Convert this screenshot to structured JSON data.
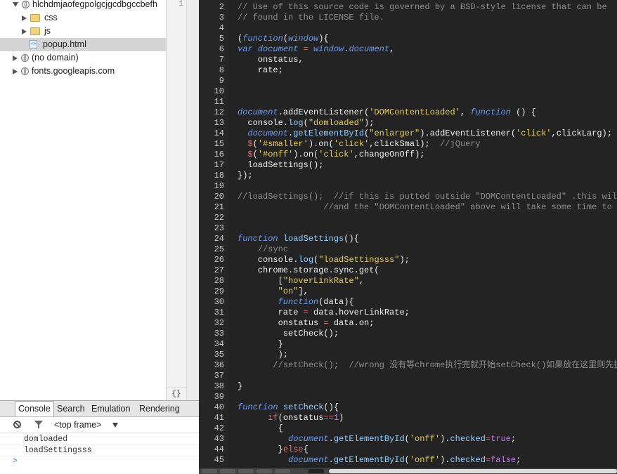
{
  "tree": {
    "root": "hlchdmjaofegpolgcjgcdbgccbefh",
    "items": [
      {
        "label": "css",
        "kind": "folder"
      },
      {
        "label": "js",
        "kind": "folder"
      },
      {
        "label": "popup.html",
        "kind": "html",
        "selected": true
      }
    ],
    "others": [
      "(no domain)",
      "fonts.googleapis.com"
    ]
  },
  "gutter_top_number": "1",
  "pretty_print_label": "{}",
  "drawer": {
    "tabs": [
      "Console",
      "Search",
      "Emulation",
      "Rendering"
    ],
    "active_tab": "Console",
    "frame_selector": "<top frame>",
    "messages": [
      "domloaded",
      "loadSettingsss"
    ],
    "prompt": ">"
  },
  "code": {
    "lines": [
      {
        "n": "2",
        "segs": [
          [
            "c",
            "// Use of this source code is governed by a BSD-style license that can be"
          ]
        ]
      },
      {
        "n": "3",
        "segs": [
          [
            "c",
            "// found in the LICENSE file."
          ]
        ]
      },
      {
        "n": "4",
        "segs": []
      },
      {
        "n": "5",
        "segs": [
          [
            "t",
            "("
          ],
          [
            "k",
            "function"
          ],
          [
            "t",
            "("
          ],
          [
            "v",
            "window"
          ],
          [
            "t",
            "){"
          ]
        ]
      },
      {
        "n": "6",
        "segs": [
          [
            "k",
            "var "
          ],
          [
            "v",
            "document"
          ],
          [
            "t",
            " "
          ],
          [
            "p",
            "="
          ],
          [
            "t",
            " "
          ],
          [
            "v",
            "window"
          ],
          [
            "t",
            "."
          ],
          [
            "v",
            "document"
          ],
          [
            "t",
            ","
          ]
        ]
      },
      {
        "n": "7",
        "segs": [
          [
            "t",
            "    onstatus,"
          ]
        ]
      },
      {
        "n": "8",
        "segs": [
          [
            "t",
            "    rate;"
          ]
        ]
      },
      {
        "n": "9",
        "segs": []
      },
      {
        "n": "10",
        "segs": []
      },
      {
        "n": "11",
        "segs": []
      },
      {
        "n": "12",
        "segs": [
          [
            "v",
            "document"
          ],
          [
            "t",
            ".addEventListener("
          ],
          [
            "s",
            "'DOMContentLoaded'"
          ],
          [
            "t",
            ", "
          ],
          [
            "k",
            "function"
          ],
          [
            "t",
            " () {"
          ]
        ]
      },
      {
        "n": "13",
        "segs": [
          [
            "t",
            "  console."
          ],
          [
            "f",
            "log"
          ],
          [
            "t",
            "("
          ],
          [
            "s",
            "\"domloaded\""
          ],
          [
            "t",
            ");"
          ]
        ]
      },
      {
        "n": "14",
        "segs": [
          [
            "t",
            "  "
          ],
          [
            "v",
            "document"
          ],
          [
            "t",
            "."
          ],
          [
            "f",
            "getElementById"
          ],
          [
            "t",
            "("
          ],
          [
            "s",
            "\"enlarger\""
          ],
          [
            "t",
            ").addEventListener("
          ],
          [
            "s",
            "'click'"
          ],
          [
            "t",
            ",clickLarg); //"
          ]
        ]
      },
      {
        "n": "15",
        "segs": [
          [
            "t",
            "  "
          ],
          [
            "p",
            "$"
          ],
          [
            "t",
            "("
          ],
          [
            "s",
            "'#smaller'"
          ],
          [
            "t",
            ").on("
          ],
          [
            "s",
            "'click'"
          ],
          [
            "t",
            ",clickSmal);  "
          ],
          [
            "c",
            "//jQuery"
          ]
        ]
      },
      {
        "n": "16",
        "segs": [
          [
            "t",
            "  "
          ],
          [
            "p",
            "$"
          ],
          [
            "t",
            "("
          ],
          [
            "s",
            "'#onff'"
          ],
          [
            "t",
            ").on("
          ],
          [
            "s",
            "'click'"
          ],
          [
            "t",
            ",changeOnOff);"
          ]
        ]
      },
      {
        "n": "17",
        "segs": [
          [
            "t",
            "  loadSettings();"
          ]
        ]
      },
      {
        "n": "18",
        "segs": [
          [
            "t",
            "});"
          ]
        ]
      },
      {
        "n": "19",
        "segs": []
      },
      {
        "n": "20",
        "segs": [
          [
            "c",
            "//loadSettings();  //if this is putted outside \"DOMContentLoaded\" .this will"
          ]
        ]
      },
      {
        "n": "21",
        "segs": [
          [
            "c",
            "                 //and the \"DOMContentLoaded\" above will take some time to be"
          ]
        ]
      },
      {
        "n": "22",
        "segs": []
      },
      {
        "n": "23",
        "segs": []
      },
      {
        "n": "24",
        "segs": [
          [
            "k",
            "function "
          ],
          [
            "f",
            "loadSettings"
          ],
          [
            "t",
            "(){"
          ]
        ]
      },
      {
        "n": "25",
        "segs": [
          [
            "t",
            "    "
          ],
          [
            "c",
            "//sync"
          ]
        ]
      },
      {
        "n": "26",
        "segs": [
          [
            "t",
            "    console."
          ],
          [
            "f",
            "log"
          ],
          [
            "t",
            "("
          ],
          [
            "s",
            "\"loadSettingsss\""
          ],
          [
            "t",
            ");"
          ]
        ]
      },
      {
        "n": "27",
        "segs": [
          [
            "t",
            "    chrome.storage.sync.get("
          ]
        ]
      },
      {
        "n": "28",
        "segs": [
          [
            "t",
            "        ["
          ],
          [
            "s",
            "\"hoverLinkRate\""
          ],
          [
            "t",
            ","
          ]
        ]
      },
      {
        "n": "29",
        "segs": [
          [
            "t",
            "        "
          ],
          [
            "s",
            "\"on\""
          ],
          [
            "t",
            "],"
          ]
        ]
      },
      {
        "n": "30",
        "segs": [
          [
            "t",
            "        "
          ],
          [
            "k",
            "function"
          ],
          [
            "t",
            "(data){"
          ]
        ]
      },
      {
        "n": "31",
        "segs": [
          [
            "t",
            "        rate "
          ],
          [
            "p",
            "="
          ],
          [
            "t",
            " data.hoverLinkRate;"
          ]
        ]
      },
      {
        "n": "32",
        "segs": [
          [
            "t",
            "        onstatus "
          ],
          [
            "p",
            "="
          ],
          [
            "t",
            " data.on;"
          ]
        ]
      },
      {
        "n": "33",
        "segs": [
          [
            "t",
            "         setCheck();"
          ]
        ]
      },
      {
        "n": "34",
        "segs": [
          [
            "t",
            "        }"
          ]
        ]
      },
      {
        "n": "35",
        "segs": [
          [
            "t",
            "        );"
          ]
        ]
      },
      {
        "n": "36",
        "segs": [
          [
            "t",
            "       "
          ],
          [
            "c",
            "//setCheck();  //wrong 没有等chrome执行完就开始setCheck()如果放在这里则先执行"
          ]
        ]
      },
      {
        "n": "37",
        "segs": []
      },
      {
        "n": "38",
        "segs": [
          [
            "t",
            "}"
          ]
        ]
      },
      {
        "n": "39",
        "segs": []
      },
      {
        "n": "40",
        "segs": [
          [
            "k",
            "function "
          ],
          [
            "f",
            "setCheck"
          ],
          [
            "t",
            "(){"
          ]
        ]
      },
      {
        "n": "41",
        "segs": [
          [
            "t",
            "      "
          ],
          [
            "p",
            "if"
          ],
          [
            "t",
            "(onstatus"
          ],
          [
            "p",
            "=="
          ],
          [
            "n",
            "1"
          ],
          [
            "t",
            ")"
          ]
        ]
      },
      {
        "n": "42",
        "segs": [
          [
            "t",
            "        {"
          ]
        ]
      },
      {
        "n": "43",
        "segs": [
          [
            "t",
            "          "
          ],
          [
            "v",
            "document"
          ],
          [
            "t",
            "."
          ],
          [
            "f",
            "getElementById"
          ],
          [
            "t",
            "("
          ],
          [
            "s",
            "'onff'"
          ],
          [
            "t",
            ")."
          ],
          [
            "f",
            "checked"
          ],
          [
            "p",
            "="
          ],
          [
            "n",
            "true"
          ],
          [
            "t",
            ";"
          ]
        ]
      },
      {
        "n": "44",
        "segs": [
          [
            "t",
            "        }"
          ],
          [
            "p",
            "else"
          ],
          [
            "t",
            "{"
          ]
        ]
      },
      {
        "n": "45",
        "segs": [
          [
            "t",
            "          "
          ],
          [
            "v",
            "document"
          ],
          [
            "t",
            "."
          ],
          [
            "f",
            "getElementById"
          ],
          [
            "t",
            "("
          ],
          [
            "s",
            "'onff'"
          ],
          [
            "t",
            ")."
          ],
          [
            "f",
            "checked"
          ],
          [
            "p",
            "="
          ],
          [
            "n",
            "false"
          ],
          [
            "t",
            ";"
          ]
        ]
      }
    ]
  }
}
